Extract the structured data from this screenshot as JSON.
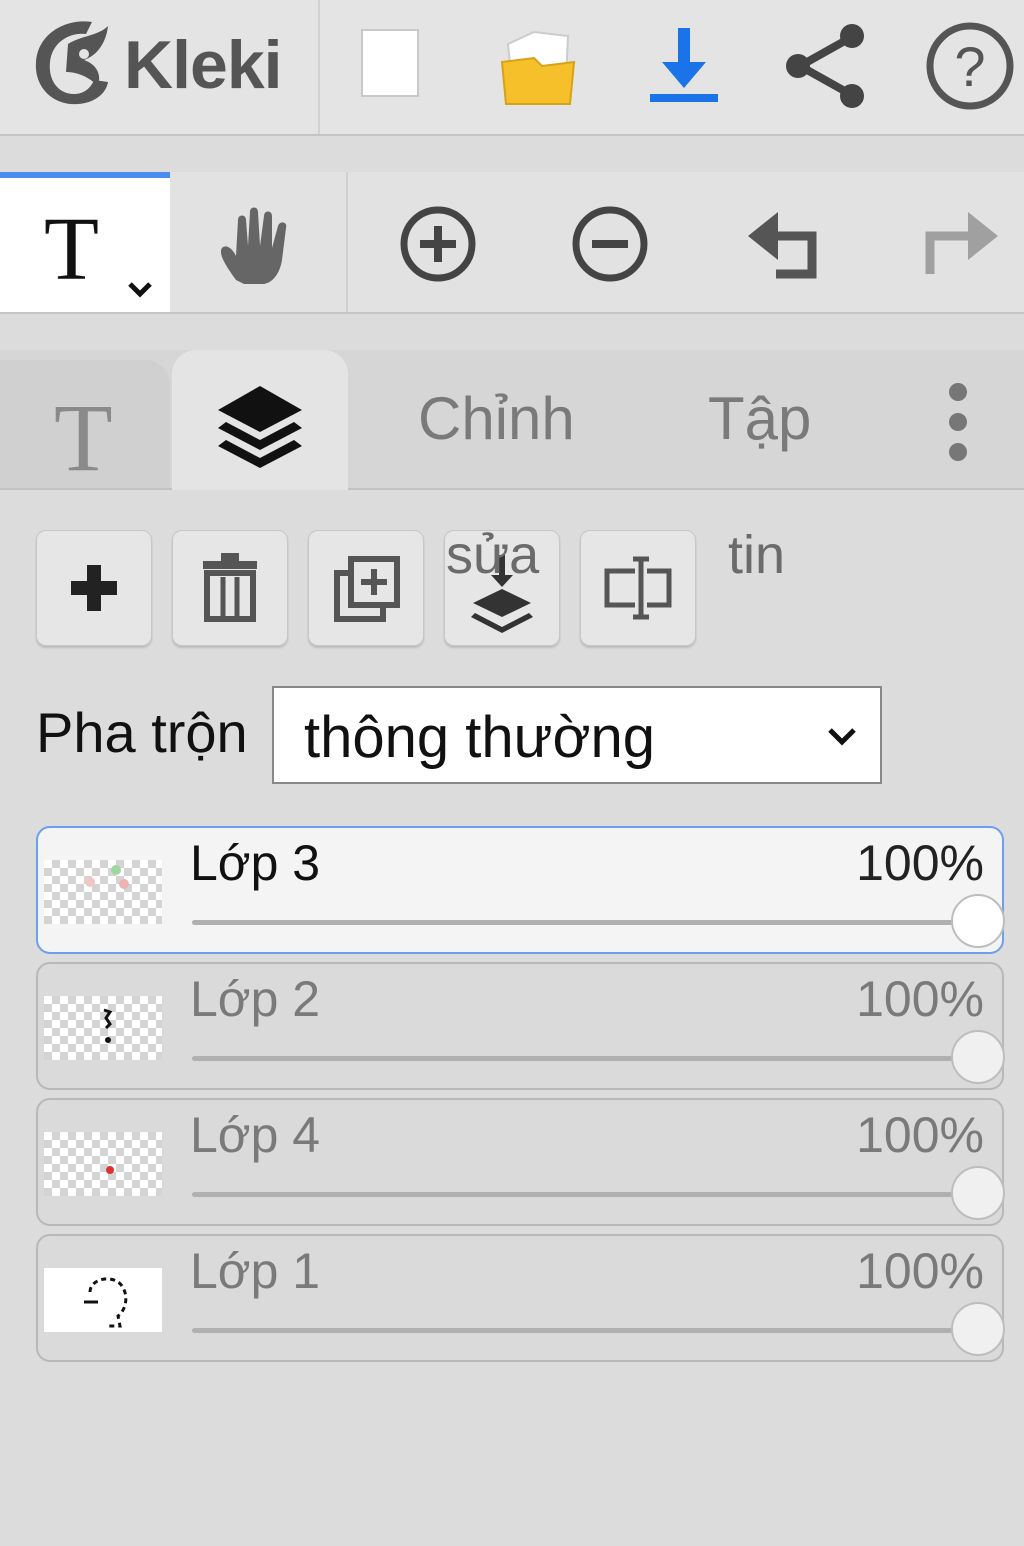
{
  "app": {
    "name": "Kleki"
  },
  "topbar": {
    "items": [
      {
        "name": "new-image-icon"
      },
      {
        "name": "open-folder-icon"
      },
      {
        "name": "download-icon",
        "color": "#1a73e8"
      },
      {
        "name": "share-icon"
      },
      {
        "name": "help-icon"
      }
    ]
  },
  "toolbar": {
    "active_tool": "text-tool",
    "tools": [
      "text-tool",
      "hand-tool",
      "zoom-in",
      "zoom-out",
      "undo",
      "redo"
    ]
  },
  "tabs": {
    "text_tab_icon": "T",
    "layers_tab_icon": "layers-icon",
    "edit_label": "Chỉnh",
    "file_label": "Tập",
    "more_icon": "more-vertical-icon"
  },
  "layers_panel": {
    "buttons": [
      "add-layer",
      "delete-layer",
      "duplicate-layer",
      "merge-down",
      "rename-layer"
    ],
    "merge_caption": "sửa",
    "rename_caption": "tin",
    "blend_label": "Pha trộn",
    "blend_value": "thông thường",
    "layers": [
      {
        "name": "Lớp 3",
        "opacity": "100%",
        "opacity_value": 1.0,
        "active": true
      },
      {
        "name": "Lớp 2",
        "opacity": "100%",
        "opacity_value": 1.0,
        "active": false
      },
      {
        "name": "Lớp 4",
        "opacity": "100%",
        "opacity_value": 1.0,
        "active": false
      },
      {
        "name": "Lớp 1",
        "opacity": "100%",
        "opacity_value": 1.0,
        "active": false
      }
    ]
  },
  "colors": {
    "accent": "#4a8cf0",
    "download": "#1a73e8",
    "folder": "#f5c02a"
  }
}
